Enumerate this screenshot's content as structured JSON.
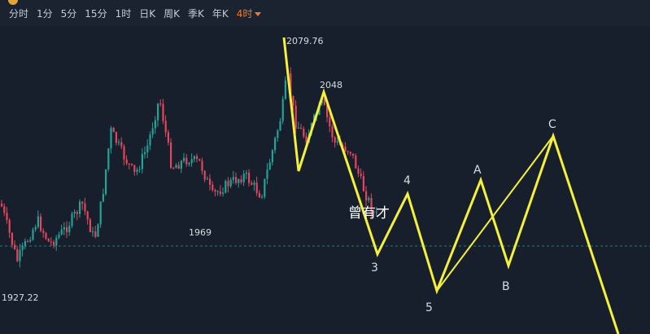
{
  "toolbar": {
    "items": [
      "分时",
      "1分",
      "5分",
      "15分",
      "1时",
      "日K",
      "周K",
      "季K",
      "年K"
    ],
    "active": "4时"
  },
  "price_labels": {
    "high": "2079.76",
    "peak2": "2048",
    "low_mid": "1969",
    "low": "1927.22"
  },
  "wave_labels": {
    "w3": "3",
    "w4": "4",
    "w5": "5",
    "wA": "A",
    "wB": "B",
    "wC": "C"
  },
  "watermark": "曾有才",
  "colors": {
    "background": "#181f2c",
    "bull": "#22a39a",
    "bear": "#e2475b",
    "wave": "#f5f03a",
    "active_tab": "#f07a2a"
  }
}
